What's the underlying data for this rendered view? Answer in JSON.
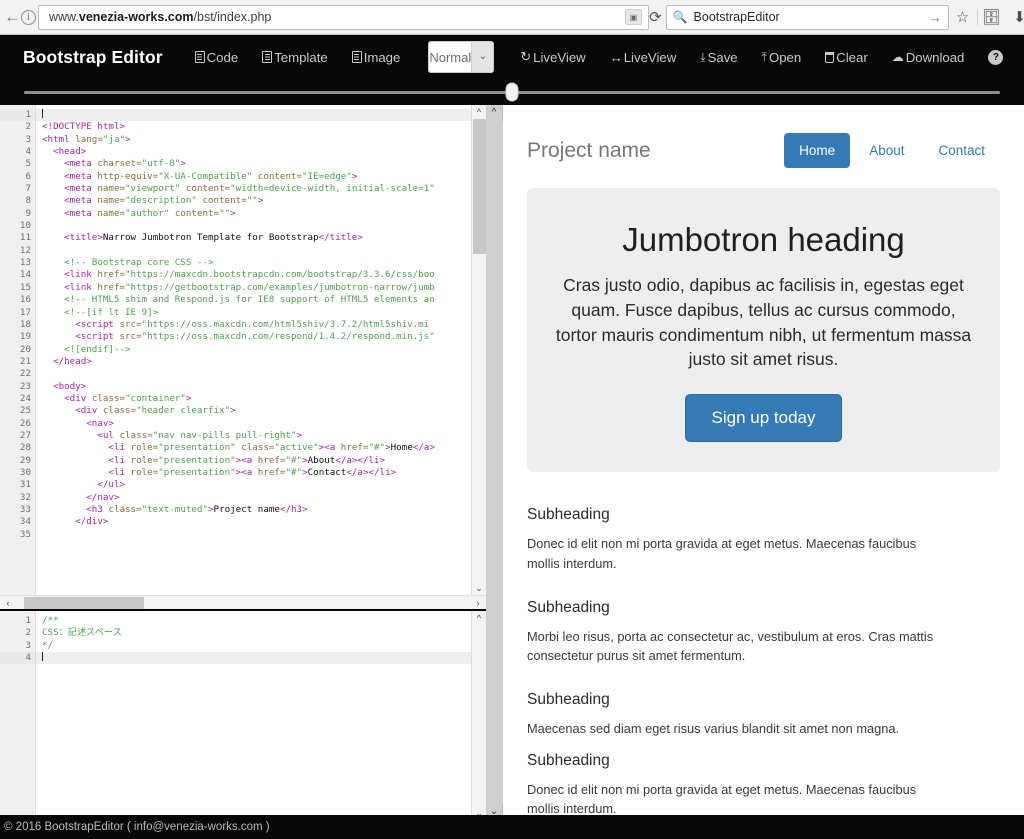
{
  "browser": {
    "url_prefix": "www.",
    "url_bold": "venezia-works.com",
    "url_suffix": "/bst/index.php",
    "url_full": "www.venezia-works.com/bst/index.php",
    "search_value": "BootstrapEditor",
    "back_icon": "back-arrow-icon",
    "info_icon": "info-icon",
    "translate_icon": "translate-icon",
    "reload_icon": "reload-icon",
    "search_icon": "search-icon",
    "go_icon": "go-arrow-icon",
    "bookmark_icon": "star-icon",
    "library_icon": "library-icon",
    "download_icon": "download-arrow-icon",
    "menu_icon": "hamburger-menu-icon"
  },
  "navbar": {
    "brand": "Bootstrap Editor",
    "items": [
      {
        "label": "Code",
        "icon": "document-icon"
      },
      {
        "label": "Template",
        "icon": "document-icon"
      },
      {
        "label": "Image",
        "icon": "document-icon"
      }
    ],
    "mode_select": {
      "value": "Normal",
      "caret": "⌄"
    },
    "actions": [
      {
        "label": "LiveView",
        "icon": "refresh-icon",
        "glyph": "↻"
      },
      {
        "label": "LiveView",
        "icon": "horizontal-arrows-icon",
        "glyph": "↔"
      }
    ],
    "tools": [
      {
        "label": "Save",
        "icon": "save-icon",
        "glyph": "⤓"
      },
      {
        "label": "Open",
        "icon": "open-icon",
        "glyph": "⤒"
      },
      {
        "label": "Clear",
        "icon": "trash-icon"
      },
      {
        "label": "Download",
        "icon": "download-cloud-icon",
        "glyph": "☁"
      }
    ],
    "help": {
      "label": "?",
      "icon": "help-icon"
    }
  },
  "split_slider": {
    "name": "pane-split-slider",
    "value_percent": 50
  },
  "html_editor": {
    "name": "html-code-editor",
    "active_line": 1,
    "lines": [
      {
        "n": 1,
        "fold": false,
        "indent": 0,
        "tokens": [
          {
            "t": "cursor",
            "v": ""
          }
        ]
      },
      {
        "n": 2,
        "fold": false,
        "indent": 0,
        "tokens": [
          {
            "t": "tag",
            "v": "<!DOCTYPE html>"
          }
        ]
      },
      {
        "n": 3,
        "fold": true,
        "indent": 0,
        "tokens": [
          {
            "t": "tag",
            "v": "<html "
          },
          {
            "t": "attr",
            "v": "lang="
          },
          {
            "t": "str",
            "v": "\"ja\""
          },
          {
            "t": "tag",
            "v": ">"
          }
        ]
      },
      {
        "n": 4,
        "fold": true,
        "indent": 1,
        "tokens": [
          {
            "t": "tag",
            "v": "<head>"
          }
        ]
      },
      {
        "n": 5,
        "fold": false,
        "indent": 2,
        "tokens": [
          {
            "t": "tag",
            "v": "<meta "
          },
          {
            "t": "attr",
            "v": "charset="
          },
          {
            "t": "str",
            "v": "\"utf-8\""
          },
          {
            "t": "tag",
            "v": ">"
          }
        ]
      },
      {
        "n": 6,
        "fold": false,
        "indent": 2,
        "tokens": [
          {
            "t": "tag",
            "v": "<meta "
          },
          {
            "t": "attr",
            "v": "http-equiv="
          },
          {
            "t": "str",
            "v": "\"X-UA-Compatible\""
          },
          {
            "t": "attr",
            "v": " content="
          },
          {
            "t": "str",
            "v": "\"IE=edge\""
          },
          {
            "t": "tag",
            "v": ">"
          }
        ]
      },
      {
        "n": 7,
        "fold": false,
        "indent": 2,
        "tokens": [
          {
            "t": "tag",
            "v": "<meta "
          },
          {
            "t": "attr",
            "v": "name="
          },
          {
            "t": "str",
            "v": "\"viewport\""
          },
          {
            "t": "attr",
            "v": " content="
          },
          {
            "t": "str",
            "v": "\"width=device-width, initial-scale=1\""
          }
        ]
      },
      {
        "n": 8,
        "fold": false,
        "indent": 2,
        "tokens": [
          {
            "t": "tag",
            "v": "<meta "
          },
          {
            "t": "attr",
            "v": "name="
          },
          {
            "t": "str",
            "v": "\"description\""
          },
          {
            "t": "attr",
            "v": " content="
          },
          {
            "t": "str",
            "v": "\"\""
          },
          {
            "t": "tag",
            "v": ">"
          }
        ]
      },
      {
        "n": 9,
        "fold": false,
        "indent": 2,
        "tokens": [
          {
            "t": "tag",
            "v": "<meta "
          },
          {
            "t": "attr",
            "v": "name="
          },
          {
            "t": "str",
            "v": "\"author\""
          },
          {
            "t": "attr",
            "v": " content="
          },
          {
            "t": "str",
            "v": "\"\""
          },
          {
            "t": "tag",
            "v": ">"
          }
        ]
      },
      {
        "n": 10,
        "fold": false,
        "indent": 0,
        "tokens": []
      },
      {
        "n": 11,
        "fold": false,
        "indent": 2,
        "tokens": [
          {
            "t": "tag",
            "v": "<title>"
          },
          {
            "t": "txt",
            "v": "Narrow Jumbotron Template for Bootstrap"
          },
          {
            "t": "tag",
            "v": "</title>"
          }
        ]
      },
      {
        "n": 12,
        "fold": false,
        "indent": 0,
        "tokens": []
      },
      {
        "n": 13,
        "fold": false,
        "indent": 2,
        "tokens": [
          {
            "t": "cmt",
            "v": "<!-- Bootstrap core CSS -->"
          }
        ]
      },
      {
        "n": 14,
        "fold": false,
        "indent": 2,
        "tokens": [
          {
            "t": "tag",
            "v": "<link "
          },
          {
            "t": "attr",
            "v": "href="
          },
          {
            "t": "str",
            "v": "\"https://maxcdn.bootstrapcdn.com/bootstrap/3.3.6/css/boo"
          }
        ]
      },
      {
        "n": 15,
        "fold": false,
        "indent": 2,
        "tokens": [
          {
            "t": "tag",
            "v": "<link "
          },
          {
            "t": "attr",
            "v": "href="
          },
          {
            "t": "str",
            "v": "\"https://getbootstrap.com/examples/jumbotron-narrow/jumb"
          }
        ]
      },
      {
        "n": 16,
        "fold": false,
        "indent": 2,
        "tokens": [
          {
            "t": "cmt",
            "v": "<!-- HTML5 shim and Respond.js for IE8 support of HTML5 elements an"
          }
        ]
      },
      {
        "n": 17,
        "fold": false,
        "indent": 2,
        "tokens": [
          {
            "t": "cmt",
            "v": "<!--[if lt IE 9]>"
          }
        ]
      },
      {
        "n": 18,
        "fold": false,
        "indent": 3,
        "tokens": [
          {
            "t": "tag",
            "v": "<script "
          },
          {
            "t": "attr",
            "v": "src="
          },
          {
            "t": "str",
            "v": "\"https://oss.maxcdn.com/html5shiv/3.7.2/html5shiv.mi"
          }
        ]
      },
      {
        "n": 19,
        "fold": false,
        "indent": 3,
        "tokens": [
          {
            "t": "tag",
            "v": "<script "
          },
          {
            "t": "attr",
            "v": "src="
          },
          {
            "t": "str",
            "v": "\"https://oss.maxcdn.com/respond/1.4.2/respond.min.js\""
          }
        ]
      },
      {
        "n": 20,
        "fold": false,
        "indent": 2,
        "tokens": [
          {
            "t": "cmt",
            "v": "<![endif]-->"
          }
        ]
      },
      {
        "n": 21,
        "fold": false,
        "indent": 1,
        "tokens": [
          {
            "t": "tag",
            "v": "</head>"
          }
        ]
      },
      {
        "n": 22,
        "fold": false,
        "indent": 0,
        "tokens": []
      },
      {
        "n": 23,
        "fold": true,
        "indent": 1,
        "tokens": [
          {
            "t": "tag",
            "v": "<body>"
          }
        ]
      },
      {
        "n": 24,
        "fold": true,
        "indent": 2,
        "tokens": [
          {
            "t": "tag",
            "v": "<div "
          },
          {
            "t": "attr",
            "v": "class="
          },
          {
            "t": "str",
            "v": "\"container\""
          },
          {
            "t": "tag",
            "v": ">"
          }
        ]
      },
      {
        "n": 25,
        "fold": true,
        "indent": 3,
        "tokens": [
          {
            "t": "tag",
            "v": "<div "
          },
          {
            "t": "attr",
            "v": "class="
          },
          {
            "t": "str",
            "v": "\"header clearfix\""
          },
          {
            "t": "tag",
            "v": ">"
          }
        ]
      },
      {
        "n": 26,
        "fold": true,
        "indent": 4,
        "tokens": [
          {
            "t": "tag",
            "v": "<nav>"
          }
        ]
      },
      {
        "n": 27,
        "fold": true,
        "indent": 5,
        "tokens": [
          {
            "t": "tag",
            "v": "<ul "
          },
          {
            "t": "attr",
            "v": "class="
          },
          {
            "t": "str",
            "v": "\"nav nav-pills pull-right\""
          },
          {
            "t": "tag",
            "v": ">"
          }
        ]
      },
      {
        "n": 28,
        "fold": false,
        "indent": 6,
        "tokens": [
          {
            "t": "tag",
            "v": "<li "
          },
          {
            "t": "attr",
            "v": "role="
          },
          {
            "t": "str",
            "v": "\"presentation\""
          },
          {
            "t": "attr",
            "v": " class="
          },
          {
            "t": "str",
            "v": "\"active\""
          },
          {
            "t": "tag",
            "v": "><a "
          },
          {
            "t": "attr",
            "v": "href="
          },
          {
            "t": "str",
            "v": "\"#\""
          },
          {
            "t": "tag",
            "v": ">"
          },
          {
            "t": "txt",
            "v": "Home"
          },
          {
            "t": "tag",
            "v": "</a>"
          }
        ]
      },
      {
        "n": 29,
        "fold": false,
        "indent": 6,
        "tokens": [
          {
            "t": "tag",
            "v": "<li "
          },
          {
            "t": "attr",
            "v": "role="
          },
          {
            "t": "str",
            "v": "\"presentation\""
          },
          {
            "t": "tag",
            "v": "><a "
          },
          {
            "t": "attr",
            "v": "href="
          },
          {
            "t": "str",
            "v": "\"#\""
          },
          {
            "t": "tag",
            "v": ">"
          },
          {
            "t": "txt",
            "v": "About"
          },
          {
            "t": "tag",
            "v": "</a></li>"
          }
        ]
      },
      {
        "n": 30,
        "fold": false,
        "indent": 6,
        "tokens": [
          {
            "t": "tag",
            "v": "<li "
          },
          {
            "t": "attr",
            "v": "role="
          },
          {
            "t": "str",
            "v": "\"presentation\""
          },
          {
            "t": "tag",
            "v": "><a "
          },
          {
            "t": "attr",
            "v": "href="
          },
          {
            "t": "str",
            "v": "\"#\""
          },
          {
            "t": "tag",
            "v": ">"
          },
          {
            "t": "txt",
            "v": "Contact"
          },
          {
            "t": "tag",
            "v": "</a></li>"
          }
        ]
      },
      {
        "n": 31,
        "fold": false,
        "indent": 5,
        "tokens": [
          {
            "t": "tag",
            "v": "</ul>"
          }
        ]
      },
      {
        "n": 32,
        "fold": false,
        "indent": 4,
        "tokens": [
          {
            "t": "tag",
            "v": "</nav>"
          }
        ]
      },
      {
        "n": 33,
        "fold": false,
        "indent": 4,
        "tokens": [
          {
            "t": "tag",
            "v": "<h3 "
          },
          {
            "t": "attr",
            "v": "class="
          },
          {
            "t": "str",
            "v": "\"text-muted\""
          },
          {
            "t": "tag",
            "v": ">"
          },
          {
            "t": "txt",
            "v": "Project name"
          },
          {
            "t": "tag",
            "v": "</h3>"
          }
        ]
      },
      {
        "n": 34,
        "fold": false,
        "indent": 3,
        "tokens": [
          {
            "t": "tag",
            "v": "</div>"
          }
        ]
      },
      {
        "n": 35,
        "fold": false,
        "indent": 0,
        "tokens": []
      }
    ]
  },
  "css_editor": {
    "name": "css-code-editor",
    "active_line": 4,
    "lines": [
      {
        "n": 1,
        "fold": true,
        "tokens": [
          {
            "t": "cmt",
            "v": "/**"
          }
        ]
      },
      {
        "n": 2,
        "fold": false,
        "tokens": [
          {
            "t": "cmt",
            "v": "CSS：記述スペース"
          }
        ]
      },
      {
        "n": 3,
        "fold": false,
        "tokens": [
          {
            "t": "cmt",
            "v": "*/"
          }
        ]
      },
      {
        "n": 4,
        "fold": false,
        "tokens": [
          {
            "t": "cursor",
            "v": ""
          }
        ]
      }
    ]
  },
  "preview": {
    "name": "live-preview",
    "project_name": "Project name",
    "nav": [
      {
        "label": "Home",
        "active": true
      },
      {
        "label": "About",
        "active": false
      },
      {
        "label": "Contact",
        "active": false
      }
    ],
    "jumbotron": {
      "heading": "Jumbotron heading",
      "paragraph": "Cras justo odio, dapibus ac facilisis in, egestas eget quam. Fusce dapibus, tellus ac cursus commodo, tortor mauris condimentum nibh, ut fermentum massa justo sit amet risus.",
      "cta_label": "Sign up today"
    },
    "sections": [
      {
        "heading": "Subheading",
        "body": "Donec id elit non mi porta gravida at eget metus. Maecenas faucibus mollis interdum."
      },
      {
        "heading": "Subheading",
        "body": "Morbi leo risus, porta ac consectetur ac, vestibulum at eros. Cras mattis consectetur purus sit amet fermentum."
      },
      {
        "heading": "Subheading",
        "body": "Maecenas sed diam eget risus varius blandit sit amet non magna."
      },
      {
        "heading": "Subheading",
        "body": "Donec id elit non mi porta gravida at eget metus. Maecenas faucibus mollis interdum."
      }
    ]
  },
  "footer": {
    "text": "© 2016 BootstrapEditor ( info@venezia-works.com )"
  },
  "colors": {
    "navbar_bg": "#070707",
    "accent_blue": "#337ab7",
    "jumbotron_bg": "#eeeeee",
    "gutter_bg": "#f0f0f0"
  }
}
